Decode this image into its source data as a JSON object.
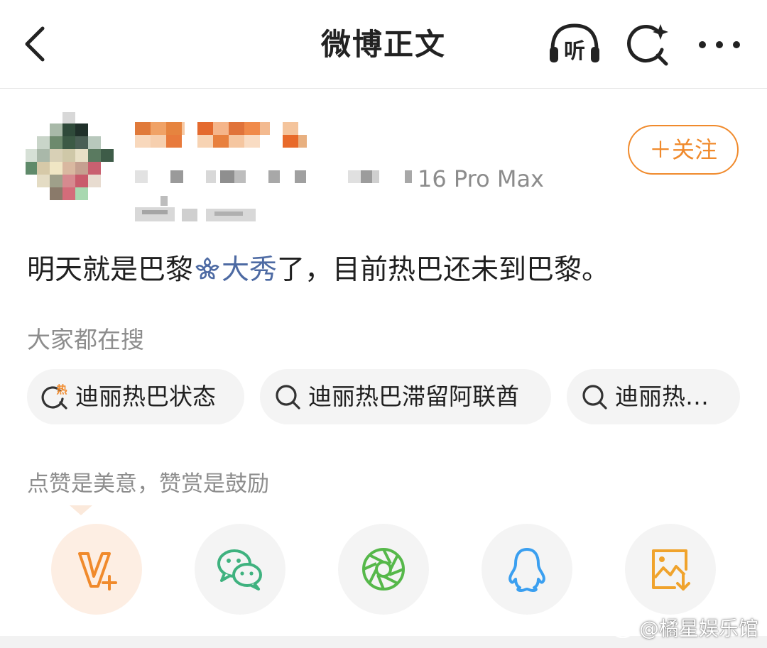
{
  "header": {
    "title": "微博正文",
    "listen_icon_text": "听"
  },
  "post": {
    "device": "16 Pro Max",
    "follow_label": "＋关注",
    "content_before": "明天就是巴黎",
    "topic": "大秀",
    "content_after": "了，目前热巴还未到巴黎。"
  },
  "hot_search": {
    "label": "大家都在搜",
    "hot_badge": "热",
    "items": [
      {
        "label": "迪丽热巴状态",
        "icon": "hot-search-icon"
      },
      {
        "label": "迪丽热巴滞留阿联酋",
        "icon": "search-icon"
      },
      {
        "label": "迪丽热…",
        "icon": "search-icon"
      }
    ]
  },
  "reward": {
    "label": "点赞是美意，赞赏是鼓励"
  },
  "share_targets": [
    {
      "name": "reward-v-plus",
      "color": "#f08a2c"
    },
    {
      "name": "wechat",
      "color": "#3fb27f"
    },
    {
      "name": "moments",
      "color": "#56b84a"
    },
    {
      "name": "qq",
      "color": "#3a9ff0"
    },
    {
      "name": "save-image",
      "color": "#f0a32c"
    }
  ],
  "watermark": "@橘星娱乐馆"
}
